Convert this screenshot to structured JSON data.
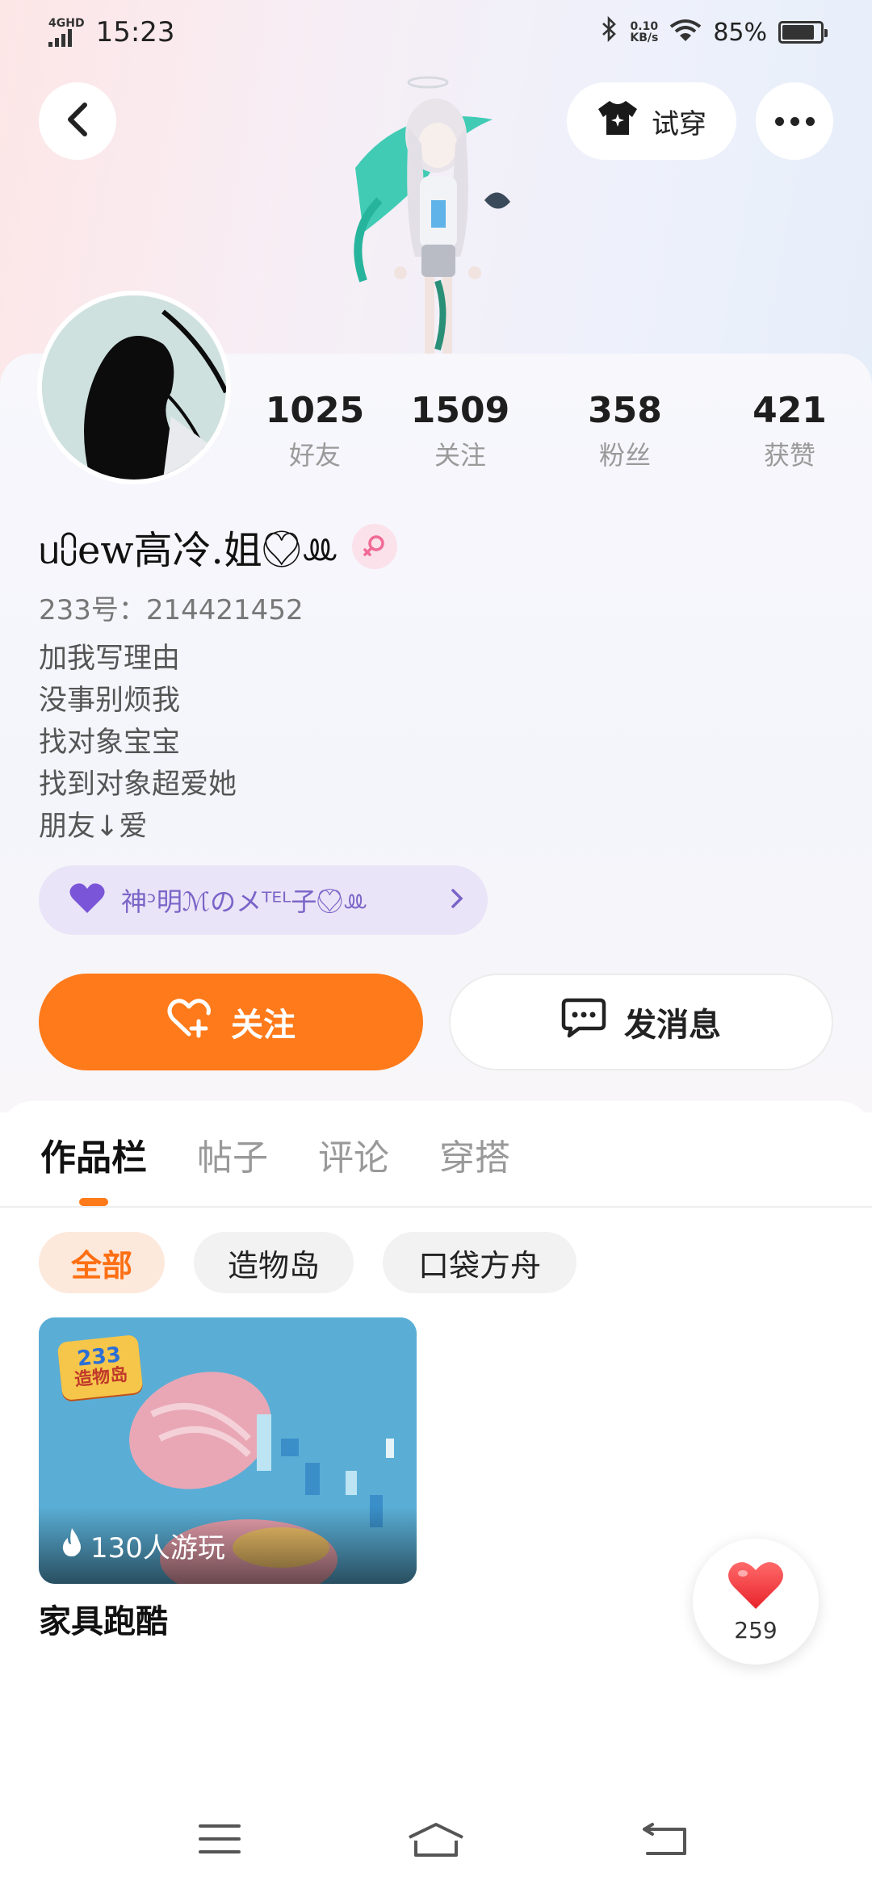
{
  "status_bar": {
    "network": "4GHD",
    "time": "15:23",
    "speed_value": "0.10",
    "speed_unit": "KB/s",
    "battery": "85%",
    "battery_level": 0.85
  },
  "header": {
    "tryon_label": "试穿"
  },
  "profile": {
    "stats": [
      {
        "value": "1025",
        "label": "好友"
      },
      {
        "value": "1509",
        "label": "关注"
      },
      {
        "value": "358",
        "label": "粉丝"
      },
      {
        "value": "421",
        "label": "获赞"
      }
    ],
    "nickname": "ᥙ⩇ew高冷.姐♡⃝ꔛ",
    "account_id": "233号：214421452",
    "bio": [
      "加我写理由",
      "没事别烦我",
      "找对象宝宝",
      "找到对象超爱她",
      "朋友↓爱"
    ],
    "group_label": "神ᵓ明ℳのメᵀᴱᴸ子♡⃝ꔛ",
    "follow_label": "关注",
    "message_label": "发消息"
  },
  "tabs": [
    "作品栏",
    "帖子",
    "评论",
    "穿搭"
  ],
  "filters": [
    "全部",
    "造物岛",
    "口袋方舟"
  ],
  "works": [
    {
      "badge_top": "233",
      "badge_bottom": "造物岛",
      "plays": "130人游玩",
      "title": "家具跑酷"
    }
  ],
  "like_fab": {
    "count": "259"
  },
  "colors": {
    "accent": "#ff7a1a",
    "group_purple": "#7a64c8",
    "pill_bg": "#e9e4f7"
  }
}
